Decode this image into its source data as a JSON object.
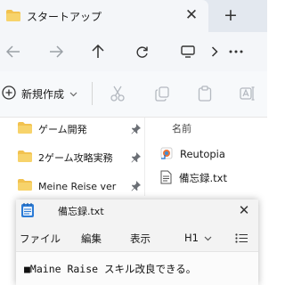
{
  "explorer": {
    "tab": {
      "title": "スタートアップ",
      "icon": "folder-icon"
    },
    "nav": {
      "back_icon": "arrow-left-icon",
      "forward_icon": "arrow-right-icon",
      "up_icon": "arrow-up-icon",
      "refresh_icon": "refresh-icon"
    },
    "commandbar": {
      "new_label": "新規作成",
      "icons": [
        "cut-icon",
        "copy-icon",
        "paste-icon",
        "rename-icon"
      ]
    },
    "sidebar": {
      "items": [
        {
          "label": "ゲーム開発",
          "pinned": true
        },
        {
          "label": "2ゲーム攻略実務",
          "pinned": true
        },
        {
          "label": "Meine Reise ver",
          "pinned": true
        }
      ]
    },
    "files": {
      "column_header": "名前",
      "items": [
        {
          "label": "Reutopia",
          "icon": "shortcut-icon"
        },
        {
          "label": "備忘録.txt",
          "icon": "text-file-icon"
        }
      ]
    }
  },
  "notepad": {
    "title": "備忘録.txt",
    "menus": [
      "ファイル",
      "編集",
      "表示"
    ],
    "heading_select": "H1",
    "content": "■Maine Raise スキル改良できる。"
  },
  "colors": {
    "folder": "#f2c24f",
    "accent": "#0067c0",
    "notepad_icon": "#2b7bd6"
  }
}
